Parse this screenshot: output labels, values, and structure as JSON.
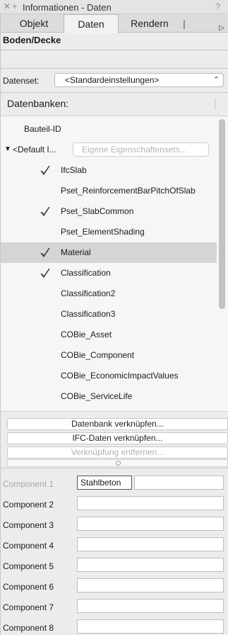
{
  "window": {
    "title": "Informationen - Daten",
    "close_glyph": "✕",
    "plus_glyph": "+",
    "help_glyph": "?"
  },
  "tabs": [
    {
      "label": "Objekt"
    },
    {
      "label": "Daten",
      "active": true
    },
    {
      "label": "Rendern"
    }
  ],
  "tab_separator": "|",
  "tab_overflow_glyph": "▷",
  "object_type": "Boden/Decke",
  "datenset": {
    "label": "Datenset:",
    "value": "<Standardeinstellungen>",
    "arrows": "⌃⌄"
  },
  "databases": {
    "header": "Datenbanken:",
    "rows": [
      {
        "label": "Bauteil-ID",
        "checked": false,
        "indent": "top"
      },
      {
        "label": "<Default I...",
        "expandable": true,
        "input_placeholder": "Eigene Eigenschaftensets..."
      },
      {
        "label": "IfcSlab",
        "checked": true
      },
      {
        "label": "Pset_ReinforcementBarPitchOfSlab",
        "checked": false
      },
      {
        "label": "Pset_SlabCommon",
        "checked": true
      },
      {
        "label": "Pset_ElementShading",
        "checked": false
      },
      {
        "label": "Material",
        "checked": true,
        "selected": true
      },
      {
        "label": "Classification",
        "checked": true
      },
      {
        "label": "Classification2",
        "checked": false
      },
      {
        "label": "Classification3",
        "checked": false
      },
      {
        "label": "COBie_Asset",
        "checked": false
      },
      {
        "label": "COBie_Component",
        "checked": false
      },
      {
        "label": "COBie_EconomicImpactValues",
        "checked": false
      },
      {
        "label": "COBie_ServiceLife",
        "checked": false
      }
    ]
  },
  "buttons": {
    "link_database": "Datenbank verknüpfen...",
    "link_ifc": "IFC-Daten verknüpfen...",
    "remove_link": "Verknüpfung entfernen..."
  },
  "components": [
    {
      "label": "Component 1",
      "value": "Stahlbeton",
      "dim": true,
      "active": true
    },
    {
      "label": "Component 2",
      "value": ""
    },
    {
      "label": "Component 3",
      "value": ""
    },
    {
      "label": "Component 4",
      "value": ""
    },
    {
      "label": "Component 5",
      "value": ""
    },
    {
      "label": "Component 6",
      "value": ""
    },
    {
      "label": "Component 7",
      "value": ""
    },
    {
      "label": "Component 8",
      "value": ""
    }
  ]
}
